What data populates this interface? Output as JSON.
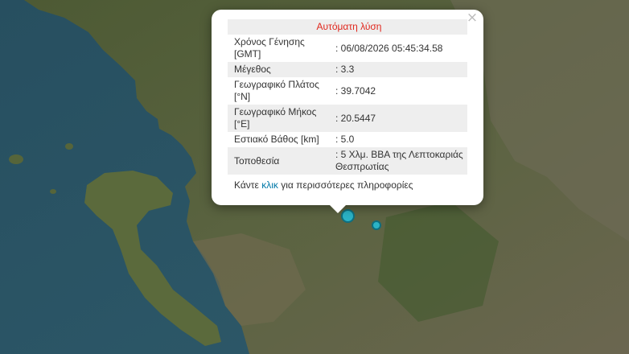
{
  "popup": {
    "title": "Αυτόματη λύση",
    "close_glyph": "×",
    "rows": [
      {
        "label": "Χρόνος Γένησης [GMT]",
        "value": ": 06/08/2026 05:45:34.58"
      },
      {
        "label": "Μέγεθος",
        "value": ": 3.3"
      },
      {
        "label": "Γεωγραφικό Πλάτος [°N]",
        "value": ": 39.7042"
      },
      {
        "label": "Γεωγραφικό Μήκος [°E]",
        "value": ": 20.5447"
      },
      {
        "label": "Εστιακό Βάθος [km]",
        "value": ": 5.0"
      },
      {
        "label": "Τοποθεσία",
        "value": ": 5 Χλμ. ΒΒΑ της Λεπτοκαριάς Θεσπρωτίας"
      }
    ],
    "footer": {
      "prefix": "Κάντε ",
      "link_text": "κλικ",
      "suffix": " για περισσότερες πληροφορίες"
    }
  },
  "colors": {
    "title_red": "#e0261c",
    "link_blue": "#0078a8",
    "marker_fill": "#2bb3c6",
    "marker_stroke": "#0e6f80"
  }
}
